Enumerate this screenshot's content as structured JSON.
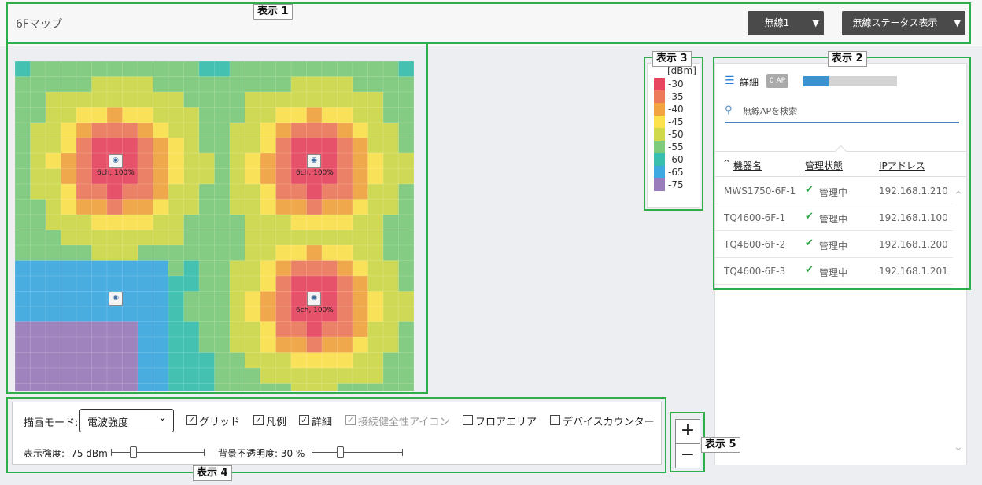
{
  "header": {
    "title": "6Fマップ",
    "wireless_select": "無線1",
    "status_select": "無線ステータス表示"
  },
  "map": {
    "ap_labels": [
      "6ch, 100%",
      "6ch, 100%",
      "6ch, 100%"
    ],
    "icon": "wifi-icon"
  },
  "legend": {
    "unit": "[dBm]",
    "items": [
      {
        "value": "-30",
        "color": "#e8465f"
      },
      {
        "value": "-35",
        "color": "#ee7a5c"
      },
      {
        "value": "-40",
        "color": "#f2a440"
      },
      {
        "value": "-45",
        "color": "#fde24e"
      },
      {
        "value": "-50",
        "color": "#cfd94a"
      },
      {
        "value": "-55",
        "color": "#7ecb7c"
      },
      {
        "value": "-60",
        "color": "#38bfae"
      },
      {
        "value": "-65",
        "color": "#3ea9e1"
      },
      {
        "value": "-75",
        "color": "#9a7cba"
      }
    ]
  },
  "side": {
    "detail_label": "詳細",
    "ap_badge": "0 AP",
    "progress": 0.27,
    "search_placeholder": "無線APを検索",
    "columns": [
      "機器名",
      "管理状態",
      "IPアドレス"
    ],
    "rows": [
      {
        "name": "MWS1750-6F-1",
        "status": "管理中",
        "ip": "192.168.1.210"
      },
      {
        "name": "TQ4600-6F-1",
        "status": "管理中",
        "ip": "192.168.1.100"
      },
      {
        "name": "TQ4600-6F-2",
        "status": "管理中",
        "ip": "192.168.1.200"
      },
      {
        "name": "TQ4600-6F-3",
        "status": "管理中",
        "ip": "192.168.1.201"
      }
    ]
  },
  "controls": {
    "mode_label": "描画モード:",
    "mode_value": "電波強度",
    "checkboxes": [
      {
        "label": "グリッド",
        "checked": true
      },
      {
        "label": "凡例",
        "checked": true
      },
      {
        "label": "詳細",
        "checked": true
      },
      {
        "label": "接続健全性アイコン",
        "checked": true,
        "disabled": true
      },
      {
        "label": "フロアエリア",
        "checked": false
      },
      {
        "label": "デバイスカウンター",
        "checked": false
      }
    ],
    "strength_label": "表示強度: -75 dBm",
    "opacity_label": "背景不透明度: 30 %"
  },
  "zoom": {
    "plus": "+",
    "minus": "−"
  },
  "annotations": [
    "表示 1",
    "表示 2",
    "表示 3",
    "表示 4",
    "表示 5"
  ]
}
